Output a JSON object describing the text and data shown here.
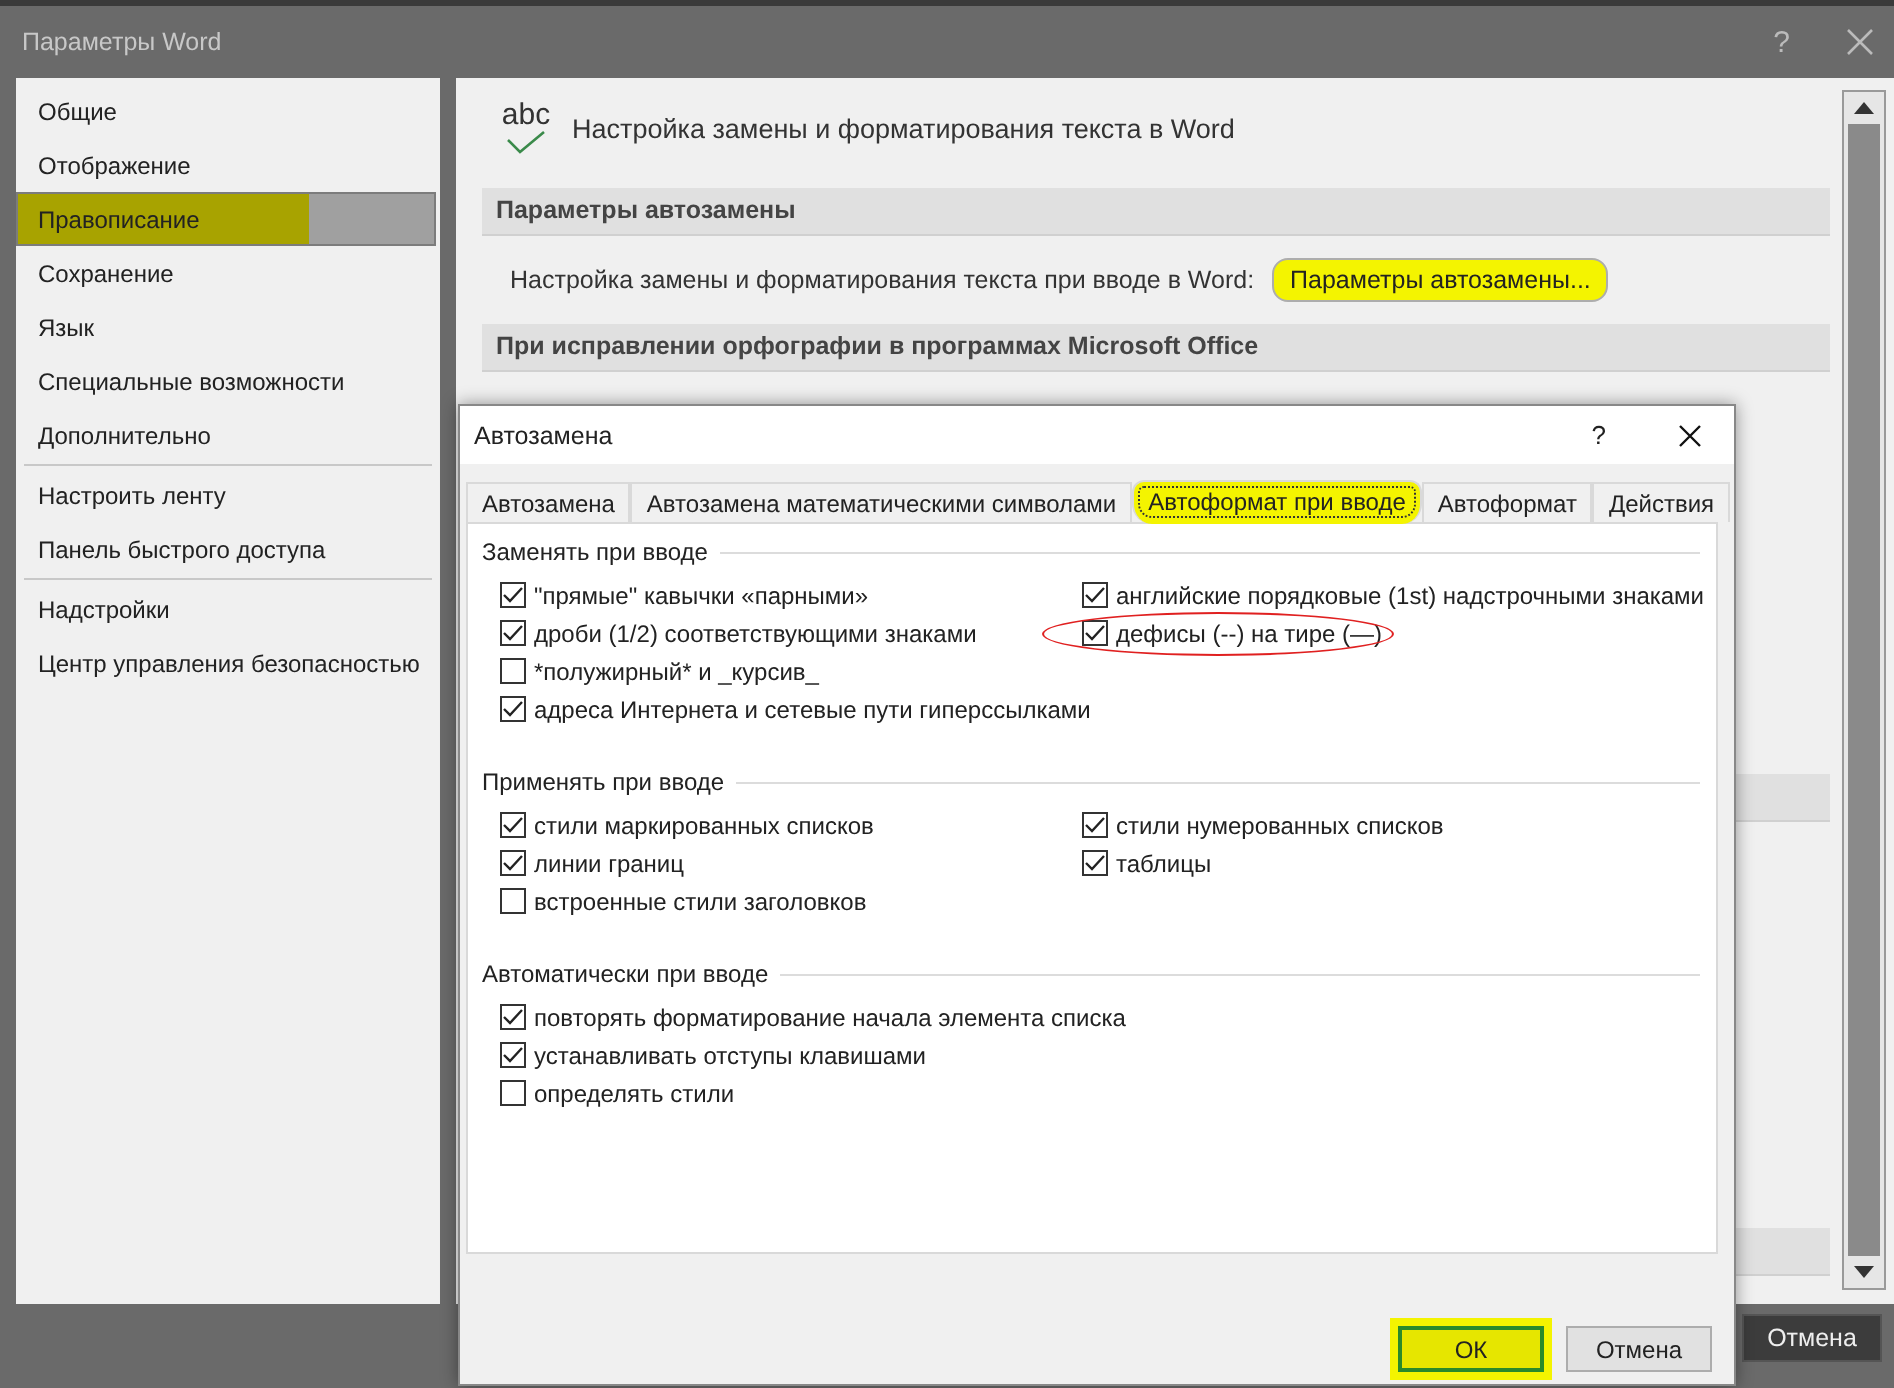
{
  "window": {
    "title": "Параметры Word",
    "help": "?"
  },
  "sidebar": {
    "groups": [
      [
        {
          "label": "Общие",
          "selected": false,
          "highlighted": false
        },
        {
          "label": "Отображение",
          "selected": false,
          "highlighted": false
        },
        {
          "label": "Правописание",
          "selected": true,
          "highlighted": true
        },
        {
          "label": "Сохранение",
          "selected": false,
          "highlighted": false
        },
        {
          "label": "Язык",
          "selected": false,
          "highlighted": false
        },
        {
          "label": "Специальные возможности",
          "selected": false,
          "highlighted": false
        },
        {
          "label": "Дополнительно",
          "selected": false,
          "highlighted": false
        }
      ],
      [
        {
          "label": "Настроить ленту",
          "selected": false,
          "highlighted": false
        },
        {
          "label": "Панель быстрого доступа",
          "selected": false,
          "highlighted": false
        }
      ],
      [
        {
          "label": "Надстройки",
          "selected": false,
          "highlighted": false
        },
        {
          "label": "Центр управления безопасностью",
          "selected": false,
          "highlighted": false
        }
      ]
    ]
  },
  "panel": {
    "icon_text": "abc",
    "heading": "Настройка замены и форматирования текста в Word",
    "sections": [
      {
        "title": "Параметры автозамены",
        "row": {
          "label": "Настройка замены и форматирования текста при вводе в Word:",
          "button": {
            "label": "Параметры автозамены...",
            "highlighted": true
          }
        }
      },
      {
        "title": "При исправлении орфографии в программах Microsoft Office"
      }
    ]
  },
  "footer": {
    "cancel": "Отмена"
  },
  "dialog": {
    "title": "Автозамена",
    "help": "?",
    "tabs": [
      {
        "label": "Автозамена",
        "selected": false,
        "highlighted": false
      },
      {
        "label": "Автозамена математическими символами",
        "selected": false,
        "highlighted": false
      },
      {
        "label": "Автоформат при вводе",
        "selected": true,
        "highlighted": true
      },
      {
        "label": "Автоформат",
        "selected": false,
        "highlighted": false
      },
      {
        "label": "Действия",
        "selected": false,
        "highlighted": false
      }
    ],
    "groups": [
      {
        "title": "Заменять при вводе",
        "columns": [
          [
            {
              "label": "\"прямые\" кавычки «парными»",
              "checked": true,
              "circled": false
            },
            {
              "label": "дроби (1/2) соответствующими знаками",
              "checked": true,
              "circled": false
            },
            {
              "label": "*полужирный* и _курсив_",
              "checked": false,
              "circled": false
            },
            {
              "label": "адреса Интернета и сетевые пути гиперссылками",
              "checked": true,
              "circled": false
            }
          ],
          [
            {
              "label": "английские порядковые (1st) надстрочными знаками",
              "checked": true,
              "circled": false
            },
            {
              "label": "дефисы (--) на тире (—)",
              "checked": true,
              "circled": true
            }
          ]
        ]
      },
      {
        "title": "Применять при вводе",
        "columns": [
          [
            {
              "label": "стили маркированных списков",
              "checked": true,
              "circled": false
            },
            {
              "label": "линии границ",
              "checked": true,
              "circled": false
            },
            {
              "label": "встроенные стили заголовков",
              "checked": false,
              "circled": false
            }
          ],
          [
            {
              "label": "стили нумерованных списков",
              "checked": true,
              "circled": false
            },
            {
              "label": "таблицы",
              "checked": true,
              "circled": false
            }
          ]
        ]
      },
      {
        "title": "Автоматически при вводе",
        "columns": [
          [
            {
              "label": "повторять форматирование начала элемента списка",
              "checked": true,
              "circled": false
            },
            {
              "label": "устанавливать отступы клавишами",
              "checked": true,
              "circled": false
            },
            {
              "label": "определять стили",
              "checked": false,
              "circled": false
            }
          ]
        ]
      }
    ],
    "buttons": [
      {
        "label": "ОК",
        "kind": "default",
        "highlighted": true
      },
      {
        "label": "Отмена",
        "kind": "normal",
        "highlighted": false
      }
    ]
  }
}
